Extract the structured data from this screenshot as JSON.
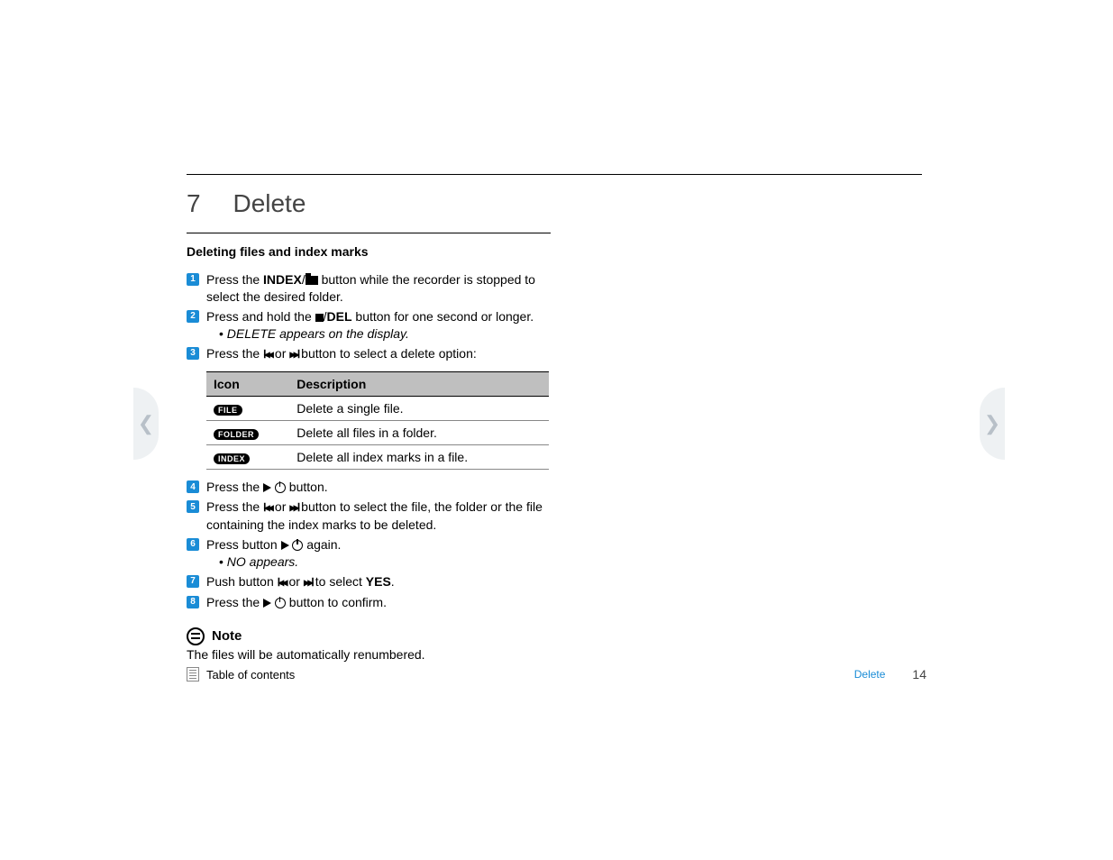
{
  "chapter": {
    "number": "7",
    "title": "Delete"
  },
  "subhead": "Deleting files and index marks",
  "steps": {
    "s1": {
      "a": "Press the ",
      "b": "INDEX",
      "c": "/",
      "d": " button while the recorder is stopped to select the desired folder."
    },
    "s2": {
      "a": "Press and hold the ",
      "b": "/",
      "c": "DEL",
      "d": " button for one second or longer.",
      "sub": "DELETE appears on the display."
    },
    "s3": {
      "a": "Press the ",
      "b": " or ",
      "c": " button to select a delete option:"
    },
    "s4": {
      "a": "Press the ",
      "b": " button."
    },
    "s5": {
      "a": "Press the ",
      "b": " or ",
      "c": " button to select the file, the folder or the file containing the index marks to be deleted."
    },
    "s6": {
      "a": "Press button ",
      "b": " again.",
      "sub": "NO appears."
    },
    "s7": {
      "a": "Push button ",
      "b": " or ",
      "c": " to select ",
      "d": "YES",
      "e": "."
    },
    "s8": {
      "a": "Press the ",
      "b": " button to confirm."
    }
  },
  "table": {
    "h1": "Icon",
    "h2": "Description",
    "r1": {
      "icon": "FILE",
      "desc": "Delete a single file."
    },
    "r2": {
      "icon": "FOLDER",
      "desc": "Delete all files in a folder."
    },
    "r3": {
      "icon": "INDEX",
      "desc": "Delete all index marks in a file."
    }
  },
  "note": {
    "label": "Note",
    "body": "The files will be automatically renumbered."
  },
  "footer": {
    "toc": "Table of contents",
    "section": "Delete",
    "page": "14"
  }
}
